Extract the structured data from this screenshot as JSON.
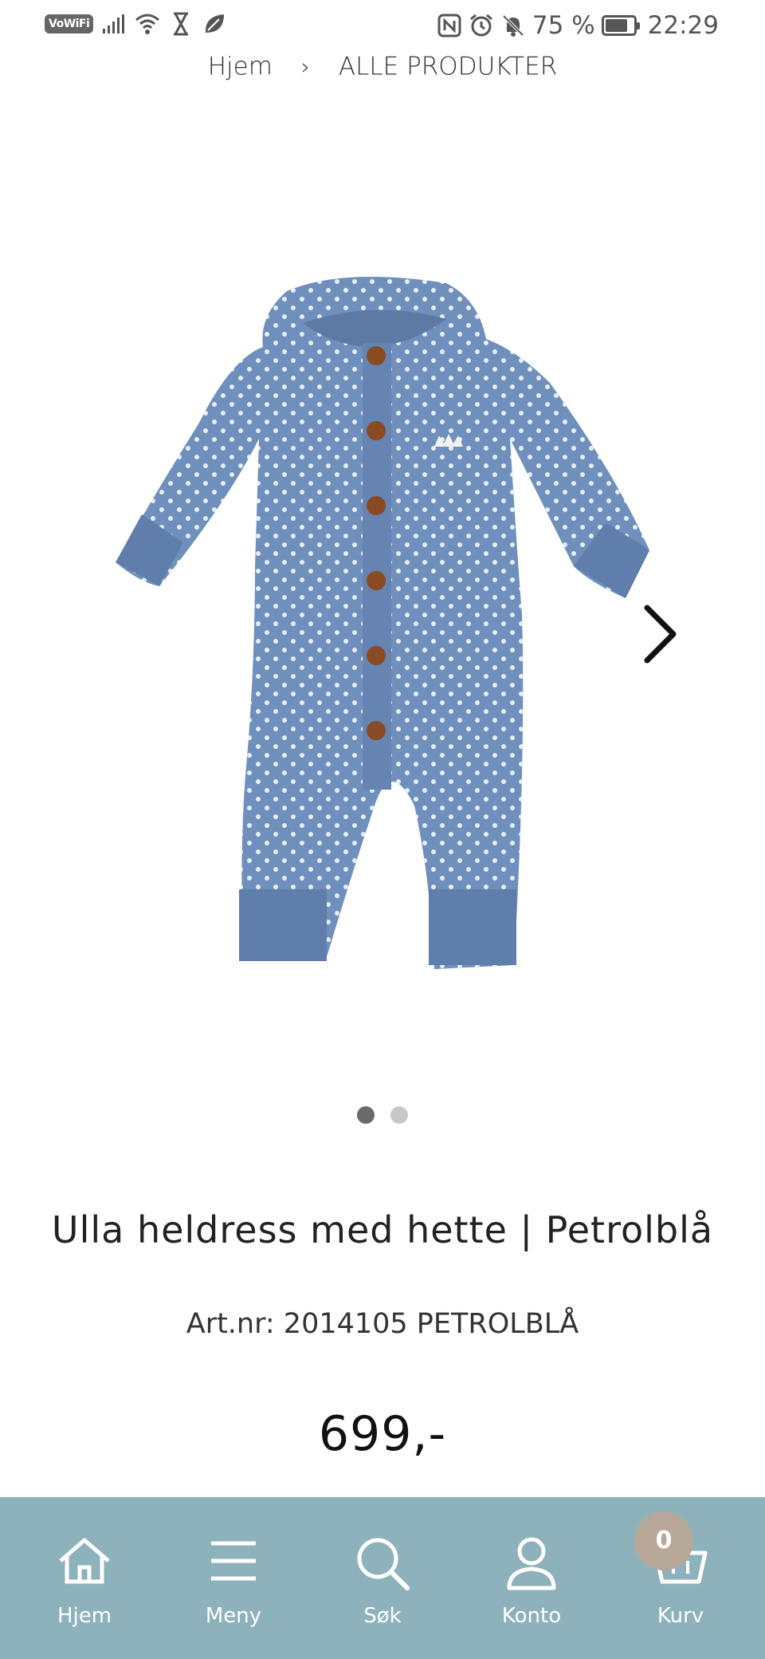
{
  "status_bar": {
    "vowifi": "VoWiFi",
    "battery_percent": "75 %",
    "time": "22:29",
    "icons_left": [
      "signal-icon",
      "wifi-icon",
      "hourglass-icon",
      "leaf-icon"
    ],
    "icons_right": [
      "nfc-icon",
      "alarm-icon",
      "bell-off-icon",
      "battery-icon"
    ]
  },
  "breadcrumb": {
    "home": "Hjem",
    "separator": "›",
    "current": "ALLE PRODUKTER"
  },
  "product": {
    "title": "Ulla heldress med hette | Petrolblå",
    "art_nr": "Art.nr: 2014105 PETROLBLÅ",
    "price": "699,-",
    "image_count": 2,
    "active_image": 1,
    "colors": {
      "garment": "#6f8fbd",
      "dots": "#e8eef6",
      "buttons": "#8a4a22"
    }
  },
  "bottom_nav": {
    "items": [
      {
        "label": "Hjem",
        "icon": "home-icon"
      },
      {
        "label": "Meny",
        "icon": "menu-icon"
      },
      {
        "label": "Søk",
        "icon": "search-icon"
      },
      {
        "label": "Konto",
        "icon": "user-icon"
      },
      {
        "label": "Kurv",
        "icon": "basket-icon"
      }
    ],
    "cart_count": "0",
    "background": "#8eb2bc",
    "badge_color": "#b8a89a"
  }
}
